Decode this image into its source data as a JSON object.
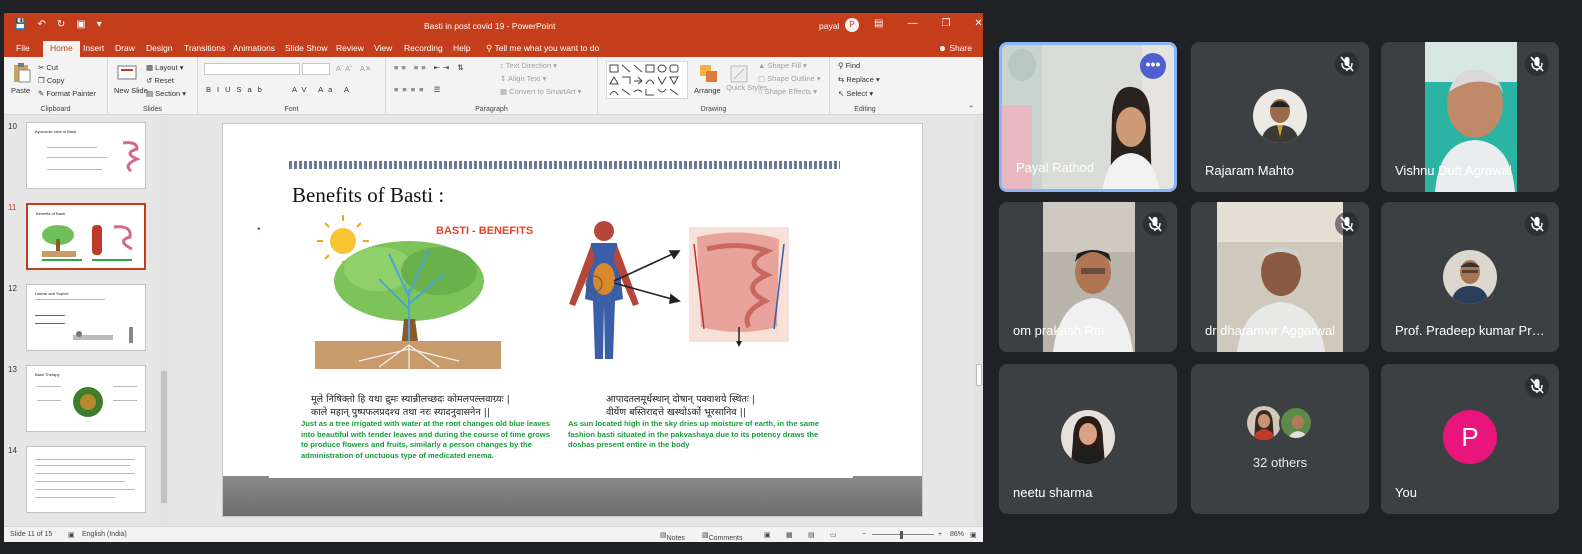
{
  "powerpoint": {
    "window_title": "Basti in post covid 19  -  PowerPoint",
    "user_name": "payal",
    "user_initial": "P",
    "tabs": [
      "File",
      "Home",
      "Insert",
      "Draw",
      "Design",
      "Transitions",
      "Animations",
      "Slide Show",
      "Review",
      "View",
      "Recording",
      "Help"
    ],
    "tell_me": "Tell me what you want to do",
    "share_label": "Share",
    "ribbon": {
      "clipboard": {
        "paste": "Paste",
        "cut": "Cut",
        "copy": "Copy",
        "format_painter": "Format Painter",
        "name": "Clipboard"
      },
      "slides": {
        "new_slide": "New Slide",
        "layout": "Layout",
        "reset": "Reset",
        "section": "Section",
        "name": "Slides"
      },
      "font": {
        "name": "Font"
      },
      "paragraph": {
        "text_direction": "Text Direction",
        "align_text": "Align Text",
        "convert_smartart": "Convert to SmartArt",
        "name": "Paragraph"
      },
      "drawing": {
        "arrange": "Arrange",
        "quick_styles": "Quick Styles",
        "shape_fill": "Shape Fill",
        "shape_outline": "Shape Outline",
        "shape_effects": "Shape Effects",
        "name": "Drawing"
      },
      "editing": {
        "find": "Find",
        "replace": "Replace",
        "select": "Select",
        "name": "Editing"
      }
    },
    "thumbnails": [
      {
        "num": "10",
        "title": "Ayurvedic view of Basti"
      },
      {
        "num": "11",
        "title": "Benefits of Basti"
      },
      {
        "num": "12",
        "title": "Lateral and Supine"
      },
      {
        "num": "13",
        "title": "Basti Therapy"
      },
      {
        "num": "14",
        "title": ""
      }
    ],
    "slide": {
      "title": "Benefits of Basti :",
      "bullet": "•",
      "picture_title": "BASTI - BENEFITS",
      "sanskrit_left_1": "मूले निषिक्तो हि यथा द्रुमः स्यान्नीलच्छदः कोमलपल्लवाग्र्यः |",
      "sanskrit_left_2": "काले महान् पुष्पफलप्रदश्च तथा नरः स्यादनुवासनेन ||",
      "sanskrit_right_1": "आपादतलमूर्धस्थान् दोषान् पक्वाशये स्थितः |",
      "sanskrit_right_2": "वीर्येण बस्तिरादत्ते खस्थोऽर्को भूरसानिव ||",
      "caption_left": "Just as a tree irrigated with water at the root changes old blue leaves into beautiful with tender leaves and during the course of time grows to produce flowers and fruits, similarly a person changes by the administration of unctuous type of medicated enema.",
      "caption_right": "As sun located high in the sky dries up moisture of earth, in the same fashion basti situated in the pakvashaya due to its potency draws the doshas present entire in the body"
    },
    "status": {
      "slide_of": "Slide 11 of 15",
      "language": "English (India)",
      "notes": "Notes",
      "comments": "Comments",
      "zoom": "86%"
    }
  },
  "meet": {
    "participants": [
      {
        "name": "Payal Rathod",
        "muted": false,
        "speaking": true
      },
      {
        "name": "Rajaram Mahto",
        "muted": true
      },
      {
        "name": "Vishnu Dutt Agrawal",
        "muted": true
      },
      {
        "name": "om prakash Rai",
        "muted": true
      },
      {
        "name": "dr dharamvir Aggarwal",
        "muted": true
      },
      {
        "name": "Prof. Pradeep kumar Prajapati",
        "muted": true
      },
      {
        "name": "neetu sharma",
        "muted": false
      },
      {
        "name": "32 others"
      },
      {
        "name": "You",
        "initial": "P",
        "muted": true
      }
    ],
    "colors": {
      "tile": "#3c4043",
      "background": "#202124",
      "active_border": "#8ab4f8",
      "you_avatar": "#e8157b",
      "ppt_accent": "#c43e1c"
    }
  }
}
